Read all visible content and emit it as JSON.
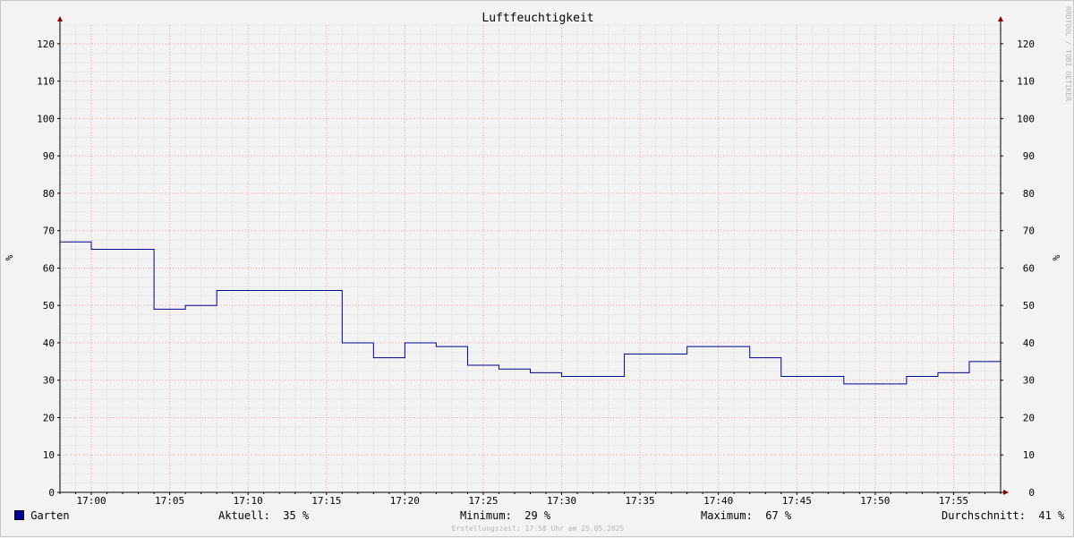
{
  "chart_data": {
    "type": "line",
    "title": "Luftfeuchtigkeit",
    "ylabel": "%",
    "ylabel_right": "%",
    "ylim": [
      0,
      125
    ],
    "yticks": [
      0,
      10,
      20,
      30,
      40,
      50,
      60,
      70,
      80,
      90,
      100,
      110,
      120
    ],
    "xlim": [
      "16:58",
      "17:58"
    ],
    "xticks": [
      "17:00",
      "17:05",
      "17:10",
      "17:15",
      "17:20",
      "17:25",
      "17:30",
      "17:35",
      "17:40",
      "17:45",
      "17:50",
      "17:55"
    ],
    "grid": true,
    "series": [
      {
        "name": "Garten",
        "color": "#000096",
        "step": true,
        "x": [
          "16:58",
          "17:00",
          "17:04",
          "17:06",
          "17:08",
          "17:16",
          "17:18",
          "17:20",
          "17:22",
          "17:24",
          "17:26",
          "17:28",
          "17:30",
          "17:34",
          "17:38",
          "17:40",
          "17:42",
          "17:44",
          "17:48",
          "17:52",
          "17:54",
          "17:56",
          "17:58"
        ],
        "values": [
          67,
          65,
          49,
          50,
          54,
          40,
          36,
          40,
          39,
          34,
          33,
          32,
          31,
          37,
          39,
          39,
          36,
          31,
          29,
          31,
          32,
          35,
          35
        ]
      }
    ]
  },
  "legend": {
    "series_name": "Garten",
    "aktuell_label": "Aktuell:",
    "aktuell_value": "35 %",
    "minimum_label": "Minimum:",
    "minimum_value": "29 %",
    "maximum_label": "Maximum:",
    "maximum_value": "67 %",
    "avg_label": "Durchschnitt:",
    "avg_value": "41 %"
  },
  "footer": "Erstellungszeit: 17:58 Uhr am 25.05.2025",
  "watermark": "RRDTOOL / TOBI OETIKER"
}
